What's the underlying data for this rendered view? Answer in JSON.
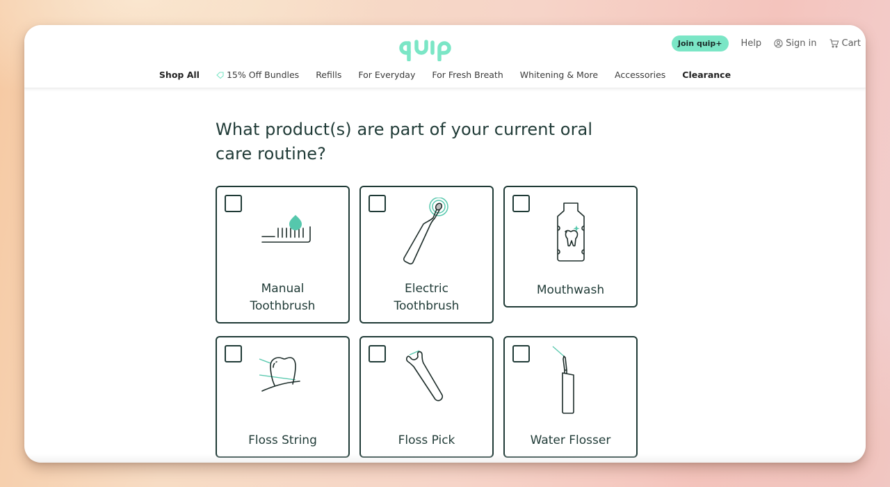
{
  "brand": {
    "logo_text": "quip",
    "accent_color": "#7be6c6",
    "ink_color": "#1f3a36"
  },
  "header": {
    "join_label": "Join quip+",
    "help_label": "Help",
    "signin_label": "Sign in",
    "signin_icon": "user-circle-icon",
    "cart_label": "Cart",
    "cart_icon": "cart-icon"
  },
  "nav": {
    "items": [
      {
        "label": "Shop All",
        "bold": true
      },
      {
        "label": "15% Off Bundles",
        "icon": "tag-icon"
      },
      {
        "label": "Refills"
      },
      {
        "label": "For Everyday"
      },
      {
        "label": "For Fresh Breath"
      },
      {
        "label": "Whitening & More"
      },
      {
        "label": "Accessories"
      },
      {
        "label": "Clearance",
        "bold": true
      }
    ]
  },
  "quiz": {
    "question": "What product(s) are part of your current oral care routine?",
    "options": [
      {
        "label": "Manual Toothbrush",
        "icon": "manual-toothbrush-icon",
        "checked": false
      },
      {
        "label": "Electric Toothbrush",
        "icon": "electric-toothbrush-icon",
        "checked": false
      },
      {
        "label": "Mouthwash",
        "icon": "mouthwash-icon",
        "checked": false
      },
      {
        "label": "Floss String",
        "icon": "floss-string-icon",
        "checked": false
      },
      {
        "label": "Floss Pick",
        "icon": "floss-pick-icon",
        "checked": false
      },
      {
        "label": "Water Flosser",
        "icon": "water-flosser-icon",
        "checked": false
      }
    ]
  }
}
